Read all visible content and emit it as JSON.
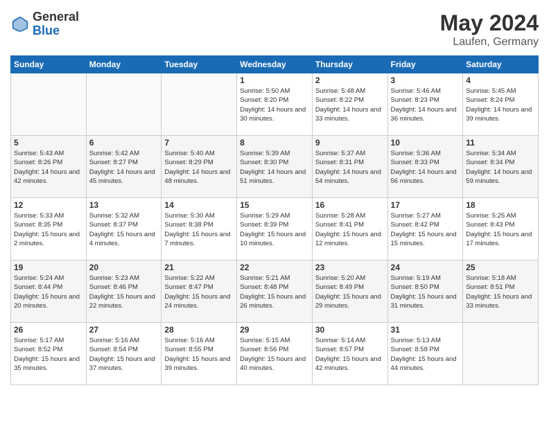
{
  "logo": {
    "general": "General",
    "blue": "Blue"
  },
  "title": {
    "month_year": "May 2024",
    "location": "Laufen, Germany"
  },
  "days_of_week": [
    "Sunday",
    "Monday",
    "Tuesday",
    "Wednesday",
    "Thursday",
    "Friday",
    "Saturday"
  ],
  "weeks": [
    [
      {
        "day": "",
        "sunrise": "",
        "sunset": "",
        "daylight": ""
      },
      {
        "day": "",
        "sunrise": "",
        "sunset": "",
        "daylight": ""
      },
      {
        "day": "",
        "sunrise": "",
        "sunset": "",
        "daylight": ""
      },
      {
        "day": "1",
        "sunrise": "Sunrise: 5:50 AM",
        "sunset": "Sunset: 8:20 PM",
        "daylight": "Daylight: 14 hours and 30 minutes."
      },
      {
        "day": "2",
        "sunrise": "Sunrise: 5:48 AM",
        "sunset": "Sunset: 8:22 PM",
        "daylight": "Daylight: 14 hours and 33 minutes."
      },
      {
        "day": "3",
        "sunrise": "Sunrise: 5:46 AM",
        "sunset": "Sunset: 8:23 PM",
        "daylight": "Daylight: 14 hours and 36 minutes."
      },
      {
        "day": "4",
        "sunrise": "Sunrise: 5:45 AM",
        "sunset": "Sunset: 8:24 PM",
        "daylight": "Daylight: 14 hours and 39 minutes."
      }
    ],
    [
      {
        "day": "5",
        "sunrise": "Sunrise: 5:43 AM",
        "sunset": "Sunset: 8:26 PM",
        "daylight": "Daylight: 14 hours and 42 minutes."
      },
      {
        "day": "6",
        "sunrise": "Sunrise: 5:42 AM",
        "sunset": "Sunset: 8:27 PM",
        "daylight": "Daylight: 14 hours and 45 minutes."
      },
      {
        "day": "7",
        "sunrise": "Sunrise: 5:40 AM",
        "sunset": "Sunset: 8:29 PM",
        "daylight": "Daylight: 14 hours and 48 minutes."
      },
      {
        "day": "8",
        "sunrise": "Sunrise: 5:39 AM",
        "sunset": "Sunset: 8:30 PM",
        "daylight": "Daylight: 14 hours and 51 minutes."
      },
      {
        "day": "9",
        "sunrise": "Sunrise: 5:37 AM",
        "sunset": "Sunset: 8:31 PM",
        "daylight": "Daylight: 14 hours and 54 minutes."
      },
      {
        "day": "10",
        "sunrise": "Sunrise: 5:36 AM",
        "sunset": "Sunset: 8:33 PM",
        "daylight": "Daylight: 14 hours and 56 minutes."
      },
      {
        "day": "11",
        "sunrise": "Sunrise: 5:34 AM",
        "sunset": "Sunset: 8:34 PM",
        "daylight": "Daylight: 14 hours and 59 minutes."
      }
    ],
    [
      {
        "day": "12",
        "sunrise": "Sunrise: 5:33 AM",
        "sunset": "Sunset: 8:35 PM",
        "daylight": "Daylight: 15 hours and 2 minutes."
      },
      {
        "day": "13",
        "sunrise": "Sunrise: 5:32 AM",
        "sunset": "Sunset: 8:37 PM",
        "daylight": "Daylight: 15 hours and 4 minutes."
      },
      {
        "day": "14",
        "sunrise": "Sunrise: 5:30 AM",
        "sunset": "Sunset: 8:38 PM",
        "daylight": "Daylight: 15 hours and 7 minutes."
      },
      {
        "day": "15",
        "sunrise": "Sunrise: 5:29 AM",
        "sunset": "Sunset: 8:39 PM",
        "daylight": "Daylight: 15 hours and 10 minutes."
      },
      {
        "day": "16",
        "sunrise": "Sunrise: 5:28 AM",
        "sunset": "Sunset: 8:41 PM",
        "daylight": "Daylight: 15 hours and 12 minutes."
      },
      {
        "day": "17",
        "sunrise": "Sunrise: 5:27 AM",
        "sunset": "Sunset: 8:42 PM",
        "daylight": "Daylight: 15 hours and 15 minutes."
      },
      {
        "day": "18",
        "sunrise": "Sunrise: 5:25 AM",
        "sunset": "Sunset: 8:43 PM",
        "daylight": "Daylight: 15 hours and 17 minutes."
      }
    ],
    [
      {
        "day": "19",
        "sunrise": "Sunrise: 5:24 AM",
        "sunset": "Sunset: 8:44 PM",
        "daylight": "Daylight: 15 hours and 20 minutes."
      },
      {
        "day": "20",
        "sunrise": "Sunrise: 5:23 AM",
        "sunset": "Sunset: 8:46 PM",
        "daylight": "Daylight: 15 hours and 22 minutes."
      },
      {
        "day": "21",
        "sunrise": "Sunrise: 5:22 AM",
        "sunset": "Sunset: 8:47 PM",
        "daylight": "Daylight: 15 hours and 24 minutes."
      },
      {
        "day": "22",
        "sunrise": "Sunrise: 5:21 AM",
        "sunset": "Sunset: 8:48 PM",
        "daylight": "Daylight: 15 hours and 26 minutes."
      },
      {
        "day": "23",
        "sunrise": "Sunrise: 5:20 AM",
        "sunset": "Sunset: 8:49 PM",
        "daylight": "Daylight: 15 hours and 29 minutes."
      },
      {
        "day": "24",
        "sunrise": "Sunrise: 5:19 AM",
        "sunset": "Sunset: 8:50 PM",
        "daylight": "Daylight: 15 hours and 31 minutes."
      },
      {
        "day": "25",
        "sunrise": "Sunrise: 5:18 AM",
        "sunset": "Sunset: 8:51 PM",
        "daylight": "Daylight: 15 hours and 33 minutes."
      }
    ],
    [
      {
        "day": "26",
        "sunrise": "Sunrise: 5:17 AM",
        "sunset": "Sunset: 8:52 PM",
        "daylight": "Daylight: 15 hours and 35 minutes."
      },
      {
        "day": "27",
        "sunrise": "Sunrise: 5:16 AM",
        "sunset": "Sunset: 8:54 PM",
        "daylight": "Daylight: 15 hours and 37 minutes."
      },
      {
        "day": "28",
        "sunrise": "Sunrise: 5:16 AM",
        "sunset": "Sunset: 8:55 PM",
        "daylight": "Daylight: 15 hours and 39 minutes."
      },
      {
        "day": "29",
        "sunrise": "Sunrise: 5:15 AM",
        "sunset": "Sunset: 8:56 PM",
        "daylight": "Daylight: 15 hours and 40 minutes."
      },
      {
        "day": "30",
        "sunrise": "Sunrise: 5:14 AM",
        "sunset": "Sunset: 8:57 PM",
        "daylight": "Daylight: 15 hours and 42 minutes."
      },
      {
        "day": "31",
        "sunrise": "Sunrise: 5:13 AM",
        "sunset": "Sunset: 8:58 PM",
        "daylight": "Daylight: 15 hours and 44 minutes."
      },
      {
        "day": "",
        "sunrise": "",
        "sunset": "",
        "daylight": ""
      }
    ]
  ]
}
